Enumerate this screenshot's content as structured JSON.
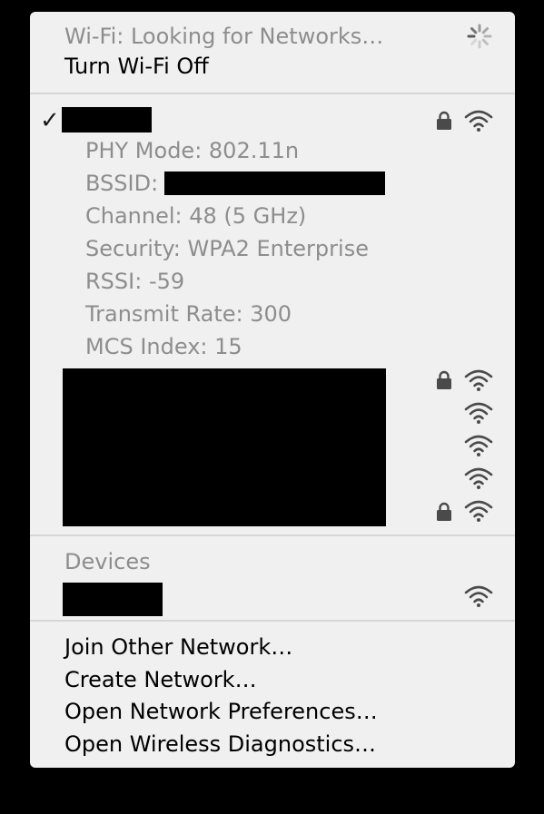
{
  "status": {
    "looking_label": "Wi-Fi: Looking for Networks…",
    "turn_off_label": "Turn Wi-Fi Off"
  },
  "current_network": {
    "checkmark": "✓",
    "details": [
      "PHY Mode: 802.11n",
      "Channel: 48 (5 GHz)",
      "Security: WPA2 Enterprise",
      "RSSI: -59",
      "Transmit Rate: 300",
      "MCS Index: 15"
    ],
    "bssid_label": "BSSID:"
  },
  "devices": {
    "header": "Devices"
  },
  "actions": [
    "Join Other Network…",
    "Create Network…",
    "Open Network Preferences…",
    "Open Wireless Diagnostics…"
  ],
  "icons": {
    "spinner": "spinner-icon",
    "lock": "lock-icon",
    "wifi": "wifi-signal-icon",
    "checkmark": "checkmark-icon"
  },
  "colors": {
    "menu_background": "#f0f0f0",
    "disabled_text": "#8d8d8d",
    "enabled_text": "#000000",
    "redaction": "#000000",
    "icon": "#4a4a4a"
  }
}
